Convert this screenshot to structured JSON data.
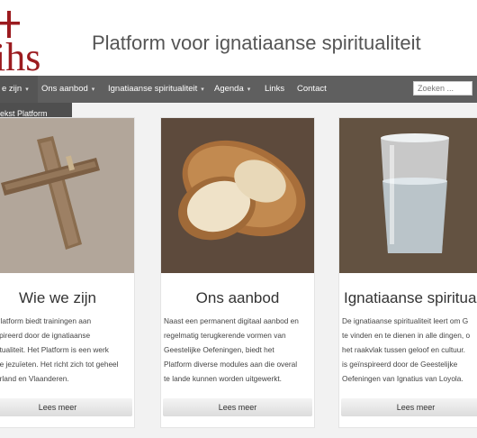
{
  "header": {
    "logo_text": "ihs",
    "site_title": "Platform voor ignatiaanse spiritualiteit"
  },
  "nav": {
    "items": [
      {
        "label": "e zijn",
        "dropdown": true
      },
      {
        "label": "Ons aanbod",
        "dropdown": true
      },
      {
        "label": "Ignatiaanse spiritualiteit",
        "dropdown": true
      },
      {
        "label": "Agenda",
        "dropdown": true
      },
      {
        "label": "Links",
        "dropdown": false
      },
      {
        "label": "Contact",
        "dropdown": false
      }
    ],
    "search_placeholder": "Zoeken ...",
    "dropdown_open_item": "ekst Platform"
  },
  "cards": [
    {
      "title": "Wie we zijn",
      "lines": [
        "Platform biedt trainingen aan",
        "spireerd door de  ignatiaanse",
        "ritualiteit. Het Platform is een werk",
        "de jezuïeten. Het richt zich tot geheel",
        "erland en Vlaanderen."
      ],
      "button": "Lees meer"
    },
    {
      "title": "Ons aanbod",
      "lines": [
        "Naast een permanent digitaal aanbod en",
        "regelmatig terugkerende vormen van",
        "Geestelijke Oefeningen, biedt het",
        "Platform diverse modules aan die overal",
        "te lande kunnen worden uitgewerkt."
      ],
      "button": "Lees meer"
    },
    {
      "title": "Ignatiaanse spiritualite",
      "lines": [
        "De ignatiaanse spiritualiteit leert om G",
        "te vinden en te dienen in alle dingen, o",
        "het raakvlak tussen geloof en cultuur.",
        "is geïnspireerd door de Geestelijke",
        "Oefeningen van Ignatius van Loyola."
      ],
      "button": "Lees meer"
    }
  ],
  "colors": {
    "logo_red": "#9b1b1f",
    "nav_bg": "#5f5f5f"
  }
}
